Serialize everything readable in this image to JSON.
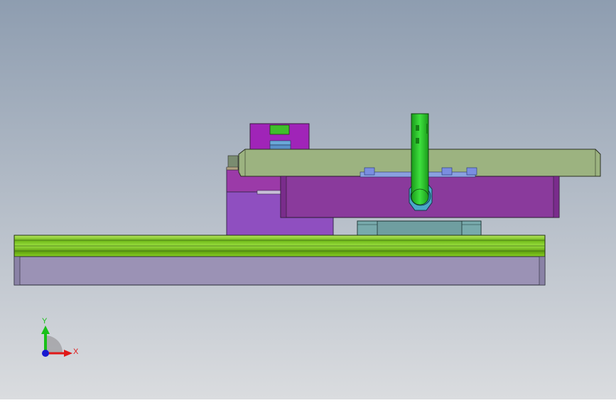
{
  "viewport": {
    "background_top": "#8e9db0",
    "background_bottom": "#dadcdf"
  },
  "triad": {
    "x_label": "X",
    "y_label": "Y",
    "x_color": "#e01818",
    "y_color": "#18c018",
    "z_color": "#1818d0"
  },
  "colors": {
    "rail_green": "#88d020",
    "base_lavender": "#9b92b5",
    "plate_sage": "#9cb380",
    "body_purple": "#8a3a9c",
    "block_violet": "#8f4fc0",
    "carriage_teal": "#6f9ea0",
    "pin_green": "#2dc42d"
  }
}
